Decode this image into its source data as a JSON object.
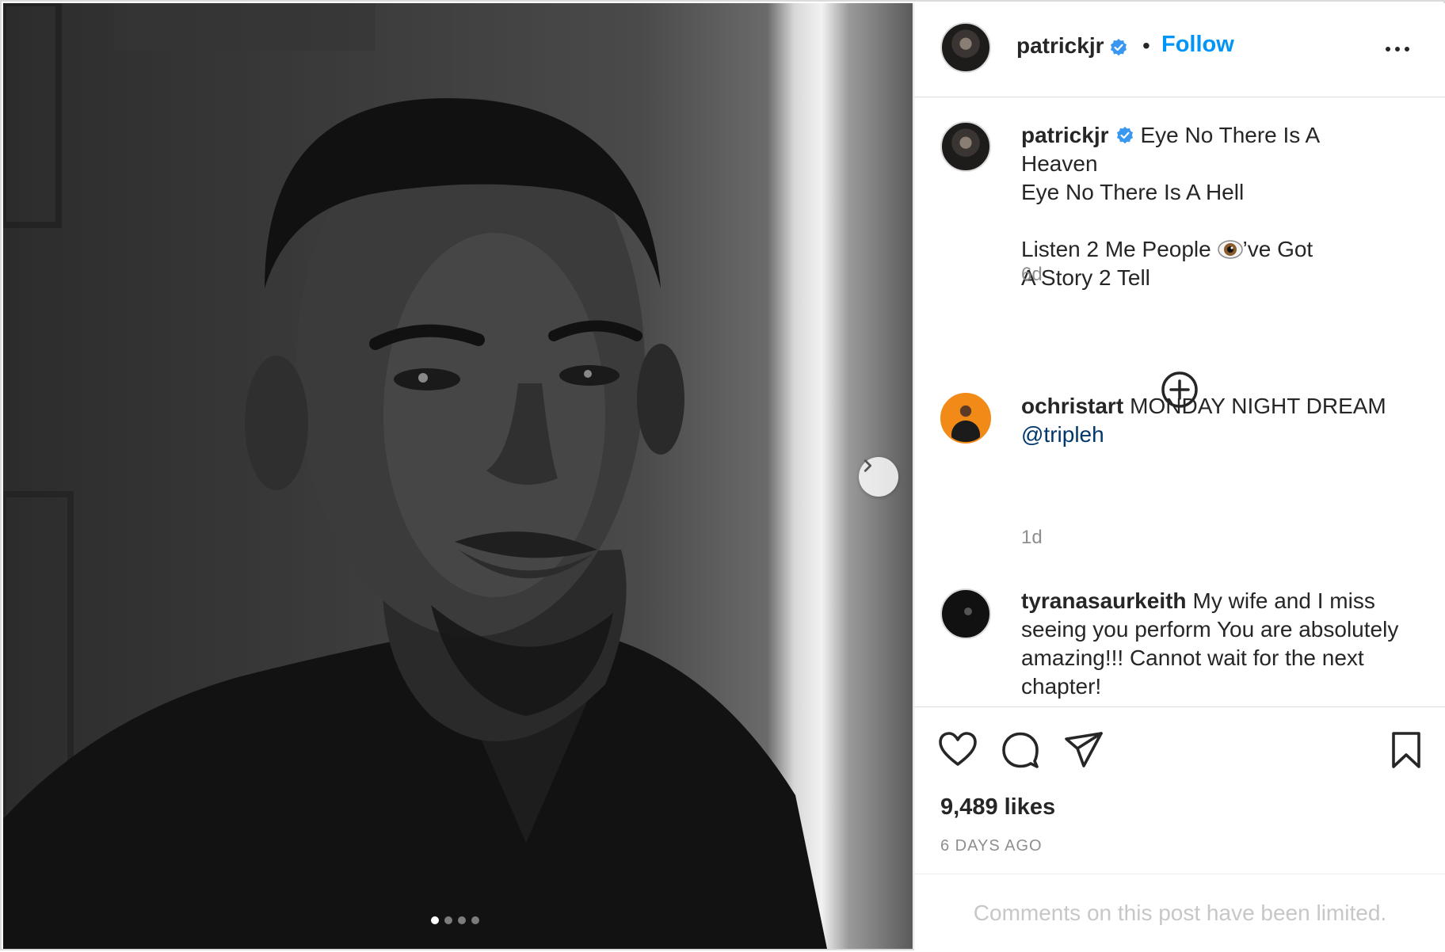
{
  "post": {
    "author": "patrickjr",
    "follow_label": "Follow",
    "separator": "•",
    "caption_lines": [
      "Eye No There Is A",
      "Heaven",
      "Eye No There Is A Hell",
      "Listen 2 Me People",
      "’ve Got",
      "A Story 2 Tell"
    ],
    "caption_time": "6d",
    "carousel": {
      "slides": 4,
      "active_index": 0
    }
  },
  "comments": [
    {
      "username": "ochristart",
      "text_line1": "MONDAY NIGHT DREAM",
      "mention": "@tripleh",
      "time": "1d"
    },
    {
      "username": "tyranasaurkeith",
      "text": "My wife and I miss seeing you perform You are absolutely amazing!!! Cannot wait for the next chapter!"
    }
  ],
  "stats": {
    "likes": "9,489 likes",
    "posted": "6 DAYS AGO"
  },
  "footer": {
    "limited_notice": "Comments on this post have been limited."
  },
  "colors": {
    "accent": "#0095f6",
    "verified": "#3897f0",
    "secondary_text": "#8e8e8e",
    "mention": "#00376b"
  },
  "icons": [
    "verified-badge-icon",
    "more-options-icon",
    "chevron-right-icon",
    "plus-circle-icon",
    "heart-icon",
    "comment-icon",
    "share-icon",
    "bookmark-icon",
    "eye-emoji"
  ]
}
